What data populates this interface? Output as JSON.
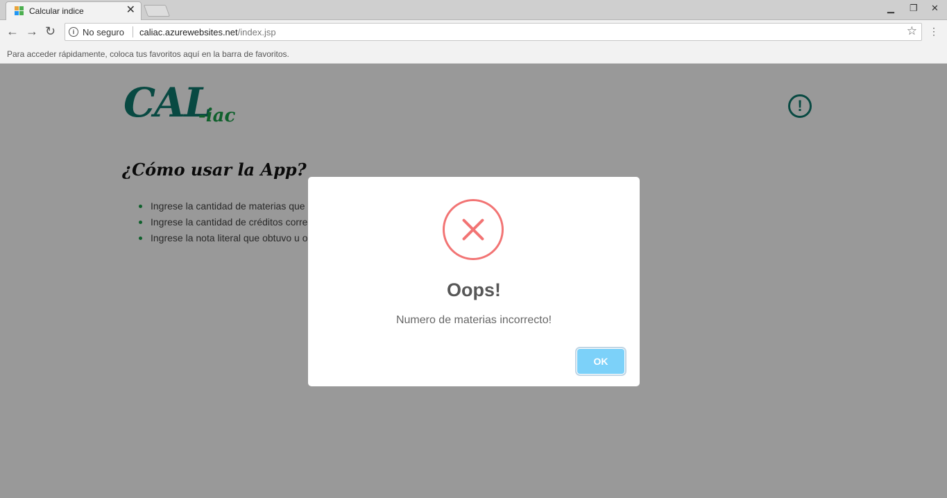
{
  "browser": {
    "tab_title": "Calcular indice",
    "tab_close": "✕",
    "security_label": "No seguro",
    "url_host": "caliac.azurewebsites.net",
    "url_path": "/index.jsp",
    "bookmarks_hint": "Para acceder rápidamente, coloca tus favoritos aquí en la barra de favoritos."
  },
  "page": {
    "logo_main": "CAL",
    "logo_suffix": "-iac",
    "heading": "¿Cómo usar la App?",
    "steps": [
      "Ingrese la cantidad de materias que cursó",
      "Ingrese la cantidad de créditos correspon",
      "Ingrese la nota literal que obtuvo u obten"
    ],
    "colors": {
      "brand": "#0e7b6e",
      "accent": "#1aa04a"
    }
  },
  "modal": {
    "title": "Oops!",
    "message": "Numero de materias incorrecto!",
    "ok_label": "OK",
    "icon": "error-x-icon",
    "colors": {
      "icon": "#f27474",
      "button": "#7cd1f9"
    }
  }
}
